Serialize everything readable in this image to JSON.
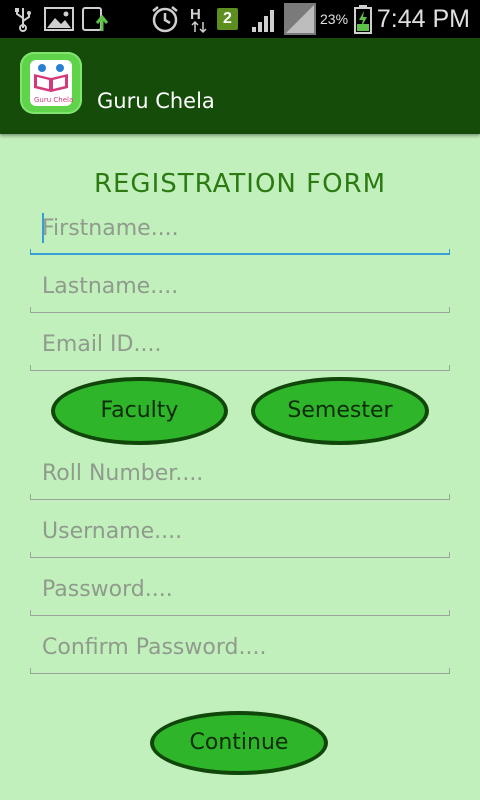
{
  "status_bar": {
    "icons": [
      "usb-icon",
      "gallery-icon",
      "upload-icon",
      "alarm-icon",
      "network-h-icon",
      "notification-badge",
      "signal-icon",
      "signal-alt-icon",
      "battery-charging-icon"
    ],
    "badge": "2",
    "battery_percent": "23%",
    "time": "7:44 PM"
  },
  "action_bar": {
    "title": "Guru Chela",
    "logo_text": "Guru Chela"
  },
  "form": {
    "title": "REGISTRATION FORM",
    "firstname_placeholder": "Firstname....",
    "lastname_placeholder": "Lastname....",
    "email_placeholder": "Email ID....",
    "faculty_label": "Faculty",
    "semester_label": "Semester",
    "roll_placeholder": "Roll Number....",
    "username_placeholder": "Username....",
    "password_placeholder": "Password....",
    "confirm_password_placeholder": "Confirm Password....",
    "continue_label": "Continue"
  },
  "colors": {
    "background": "#c2f0bc",
    "action_bar": "#154c0a",
    "title_green": "#2c7a12",
    "button_fill": "#2fb52a",
    "button_border": "#10460a",
    "focus_blue": "#3a9ed6"
  }
}
